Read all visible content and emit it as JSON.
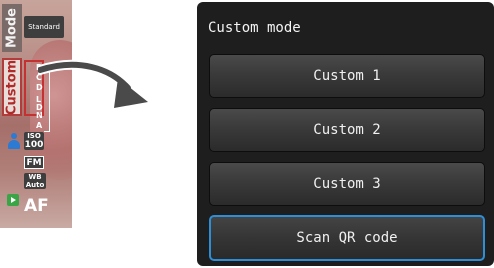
{
  "camera_strip": {
    "mode_tab": "Mode",
    "custom_tab": "Custom",
    "standard_badge": "Standard",
    "custom_chars": [
      "R",
      "C",
      "D",
      "L",
      "D",
      "N",
      "A"
    ],
    "iso_label": "ISO",
    "iso_value": "100",
    "fm_label": "FM",
    "wb_label": "WB",
    "wb_value": "Auto",
    "af_label": "AF",
    "icons": [
      "person-icon",
      "playback-icon"
    ],
    "highlight_color": "#c53030"
  },
  "custom_panel": {
    "title": "Custom mode",
    "buttons": [
      "Custom 1",
      "Custom 2",
      "Custom 3",
      "Scan QR code"
    ],
    "selected_index": 3,
    "selected_border_color": "#2f8fd6"
  }
}
